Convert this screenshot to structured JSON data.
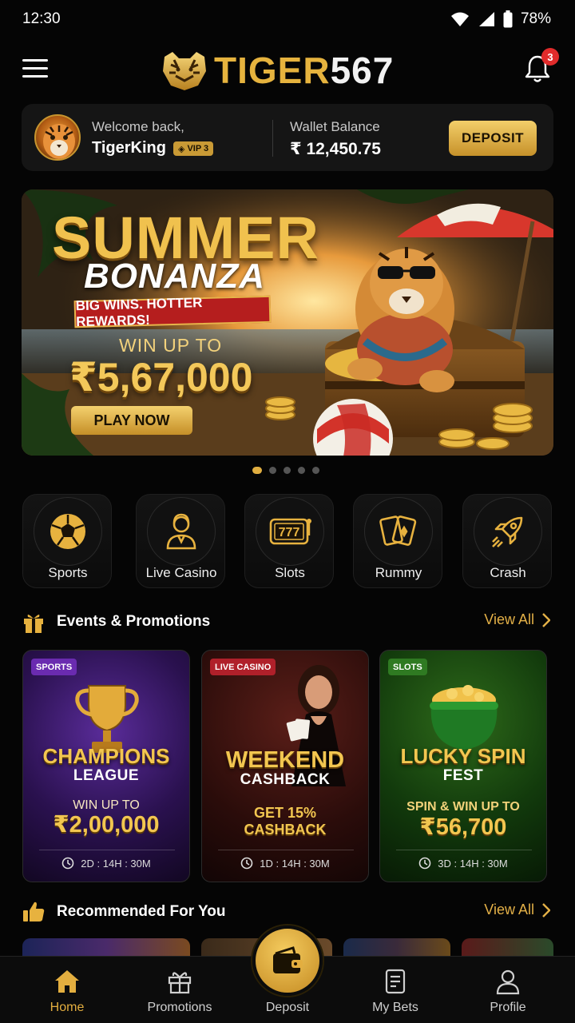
{
  "status_bar": {
    "time": "12:30",
    "battery": "78%",
    "icons": [
      "wifi-icon",
      "signal-icon",
      "battery-icon"
    ]
  },
  "header": {
    "logo_prefix": "TIGER",
    "logo_suffix": "567",
    "notification_count": "3"
  },
  "welcome": {
    "label": "Welcome back,",
    "username": "TigerKing",
    "vip": "VIP 3",
    "wallet_label": "Wallet Balance",
    "wallet_value": "₹ 12,450.75",
    "deposit_label": "DEPOSIT"
  },
  "banner": {
    "title": "SUMMER",
    "subtitle": "BONANZA",
    "ribbon": "BIG WINS. HOTTER REWARDS!",
    "win_label": "WIN UP TO",
    "amount": "₹5,67,000",
    "cta": "PLAY NOW",
    "slides": 5,
    "active_slide": 1
  },
  "categories": [
    {
      "label": "Sports",
      "icon": "soccer-ball-icon"
    },
    {
      "label": "Live Casino",
      "icon": "dealer-icon"
    },
    {
      "label": "Slots",
      "icon": "slot-machine-icon"
    },
    {
      "label": "Rummy",
      "icon": "cards-icon"
    },
    {
      "label": "Crash",
      "icon": "rocket-icon"
    }
  ],
  "events": {
    "title": "Events & Promotions",
    "view_all": "View All",
    "cards": [
      {
        "tag": "SPORTS",
        "title": "CHAMPIONS",
        "subtitle": "LEAGUE",
        "line1": "WIN UP TO",
        "amount": "₹2,00,000",
        "timer": "2D : 14H : 30M",
        "tag_color": "#6a2bb0"
      },
      {
        "tag": "LIVE CASINO",
        "title": "WEEKEND",
        "subtitle": "CASHBACK",
        "line1": "GET 15%",
        "amount": "CASHBACK",
        "timer": "1D : 14H : 30M",
        "tag_color": "#b0202a"
      },
      {
        "tag": "SLOTS",
        "title": "LUCKY SPIN",
        "subtitle": "FEST",
        "line1": "SPIN & WIN UP TO",
        "amount": "₹56,700",
        "timer": "3D : 14H : 30M",
        "tag_color": "#2f7a22"
      }
    ]
  },
  "recommended": {
    "title": "Recommended For You",
    "view_all": "View All"
  },
  "bottom_nav": [
    {
      "label": "Home",
      "icon": "home-icon",
      "active": true
    },
    {
      "label": "Promotions",
      "icon": "gift-icon",
      "active": false
    },
    {
      "label": "Deposit",
      "icon": "wallet-icon",
      "active": false
    },
    {
      "label": "My Bets",
      "icon": "bets-icon",
      "active": false
    },
    {
      "label": "Profile",
      "icon": "profile-icon",
      "active": false
    }
  ]
}
